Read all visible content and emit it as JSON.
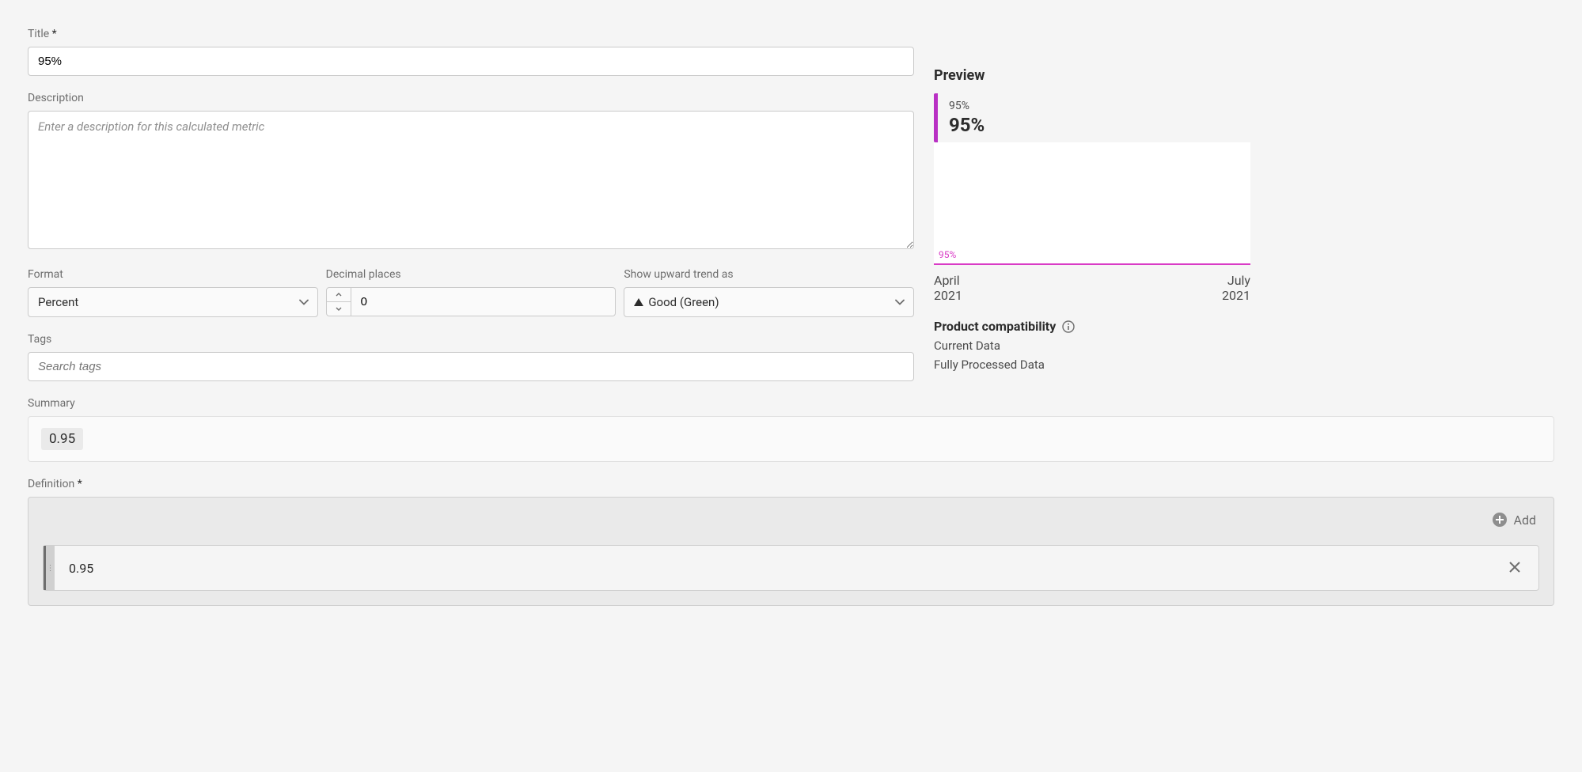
{
  "form": {
    "title_label": "Title",
    "title_value": "95%",
    "description_label": "Description",
    "description_placeholder": "Enter a description for this calculated metric",
    "format_label": "Format",
    "format_value": "Percent",
    "decimal_label": "Decimal places",
    "decimal_value": "0",
    "trend_label": "Show upward trend as",
    "trend_value": "Good (Green)",
    "tags_label": "Tags",
    "tags_placeholder": "Search tags",
    "summary_label": "Summary",
    "summary_value": "0.95",
    "definition_label": "Definition",
    "add_label": "Add",
    "definition_item_value": "0.95"
  },
  "preview": {
    "heading": "Preview",
    "small": "95%",
    "big": "95%",
    "chart_legend": "95%",
    "date_from_month": "April",
    "date_from_year": "2021",
    "date_to_month": "July",
    "date_to_year": "2021",
    "compat_title": "Product compatibility",
    "compat_items": [
      "Current Data",
      "Fully Processed Data"
    ]
  },
  "chart_data": {
    "type": "line",
    "title": "95%",
    "x_range": [
      "April 2021",
      "July 2021"
    ],
    "series": [
      {
        "name": "95%",
        "values": [
          95
        ]
      }
    ],
    "ylabel": "",
    "xlabel": ""
  }
}
